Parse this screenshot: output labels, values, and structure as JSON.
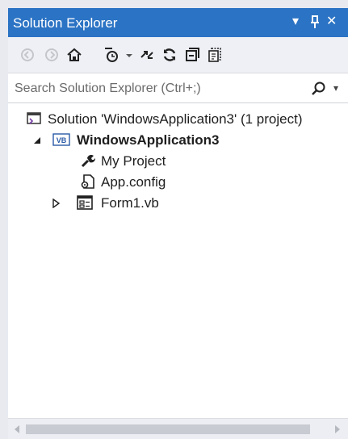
{
  "window": {
    "title": "Solution Explorer",
    "dropdown_glyph": "▾",
    "pin_glyph": "Ⴈ",
    "close_glyph": "✕"
  },
  "toolbar": {
    "buttons": [
      {
        "name": "back-icon"
      },
      {
        "name": "forward-icon"
      },
      {
        "name": "home-icon"
      },
      {
        "name": "pending-changes-filter-icon"
      },
      {
        "name": "dropdown-icon"
      },
      {
        "name": "sync-with-document-icon"
      },
      {
        "name": "refresh-icon"
      },
      {
        "name": "collapse-all-icon"
      },
      {
        "name": "show-all-files-icon"
      }
    ]
  },
  "search": {
    "placeholder": "Search Solution Explorer (Ctrl+;)"
  },
  "tree": {
    "solution_label": "Solution 'WindowsApplication3' (1 project)",
    "project_label": "WindowsApplication3",
    "project_badge": "VB",
    "items": [
      {
        "label": "My Project",
        "icon": "wrench-icon"
      },
      {
        "label": "App.config",
        "icon": "config-file-icon"
      },
      {
        "label": "Form1.vb",
        "icon": "form-icon"
      }
    ]
  },
  "colors": {
    "title_bar": "#2b73c4",
    "background": "#f3f4f8"
  }
}
